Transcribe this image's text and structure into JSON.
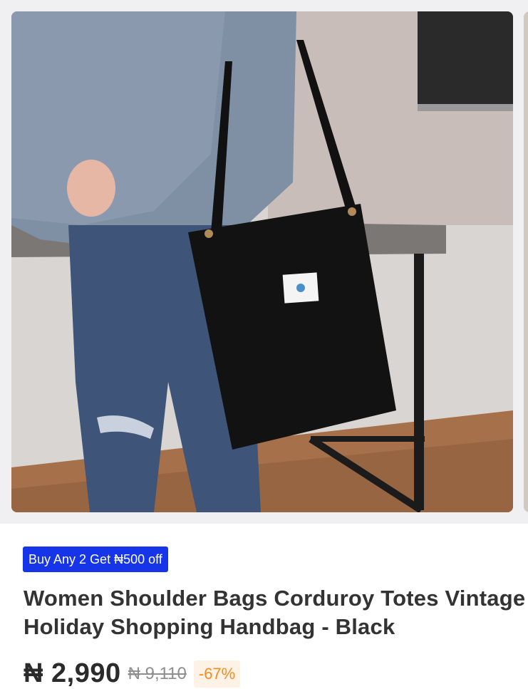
{
  "product": {
    "promo_badge": "Buy Any 2 Get ₦500 off",
    "title": "Women Shoulder Bags Corduroy Totes Vintage Holiday Shopping Handbag - Black",
    "price_current": "₦ 2,990",
    "price_old": "₦ 9,110",
    "discount": "-67%"
  },
  "colors": {
    "promo_bg": "#1635e8",
    "discount_text": "#f68b1e",
    "discount_bg": "#fef2e6",
    "old_price": "#8f8f8f"
  }
}
